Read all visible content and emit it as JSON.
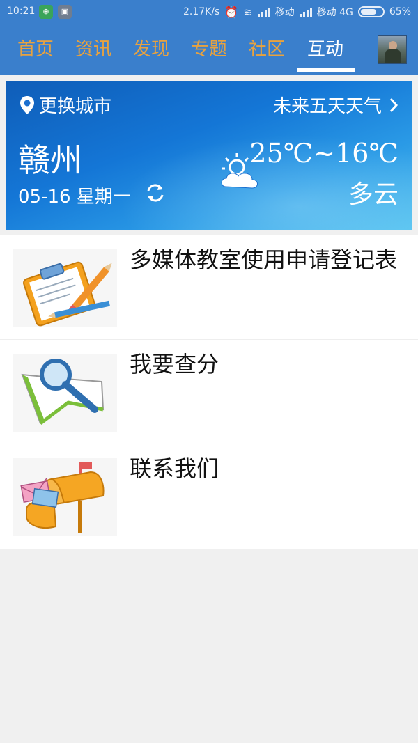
{
  "status_bar": {
    "time": "10:21",
    "net_speed": "2.17K/s",
    "carrier1": "移动",
    "carrier2": "移动 4G",
    "battery": "65%"
  },
  "nav": {
    "tabs": [
      {
        "label": "首页"
      },
      {
        "label": "资讯"
      },
      {
        "label": "发现"
      },
      {
        "label": "专题"
      },
      {
        "label": "社区"
      },
      {
        "label": "互动"
      }
    ],
    "active_tab": "互动"
  },
  "weather": {
    "change_city": "更换城市",
    "forecast_link": "未来五天天气",
    "city": "赣州",
    "date": "05-16 星期一",
    "temperature": "25℃~16℃",
    "condition": "多云"
  },
  "list": [
    {
      "title": "多媒体教室使用申请登记表",
      "icon": "clipboard-pencil-icon"
    },
    {
      "title": "我要查分",
      "icon": "book-magnifier-icon"
    },
    {
      "title": "联系我们",
      "icon": "mailbox-icon"
    }
  ],
  "colors": {
    "nav_bg": "#3a7fcc",
    "nav_inactive": "#e8a23f",
    "nav_active": "#ffffff"
  }
}
